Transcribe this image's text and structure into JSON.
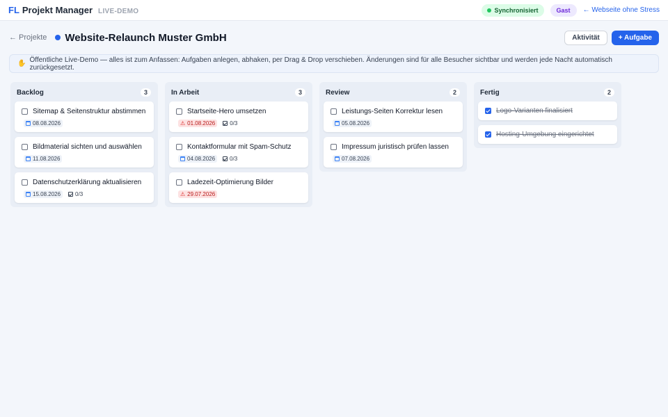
{
  "app": {
    "logo_prefix": "FL",
    "logo_name": "Projekt Manager",
    "demo_tag": "LIVE-DEMO",
    "sync_label": "Synchronisiert",
    "user_label": "Gast",
    "site_link": "← Webseite ohne Stress"
  },
  "header": {
    "back_label": "← Projekte",
    "project_title": "Website-Relaunch Muster GmbH",
    "activity_label": "Aktivität",
    "add_task_label": "+ Aufgabe"
  },
  "notice": {
    "icon": "hand-icon",
    "text": "Öffentliche Live-Demo — alles ist zum Anfassen: Aufgaben anlegen, abhaken, per Drag & Drop verschieben. Änderungen sind für alle Besucher sichtbar und werden jede Nacht automatisch zurückgesetzt."
  },
  "colors": {
    "accent": "#2563eb",
    "overdue": "#b91c1c",
    "sync": "#22c55e"
  },
  "columns": [
    {
      "title": "Backlog",
      "count": "3",
      "cards": [
        {
          "title": "Sitemap & Seitenstruktur abstimmen",
          "date": "08.08.2026",
          "overdue": false,
          "subtasks": "",
          "done": false
        },
        {
          "title": "Bildmaterial sichten und auswählen",
          "date": "11.08.2026",
          "overdue": false,
          "subtasks": "",
          "done": false
        },
        {
          "title": "Datenschutzerklärung aktualisieren",
          "date": "15.08.2026",
          "overdue": false,
          "subtasks": "0/3",
          "done": false
        }
      ]
    },
    {
      "title": "In Arbeit",
      "count": "3",
      "cards": [
        {
          "title": "Startseite-Hero umsetzen",
          "date": "01.08.2026",
          "overdue": true,
          "subtasks": "0/3",
          "done": false
        },
        {
          "title": "Kontaktformular mit Spam-Schutz",
          "date": "04.08.2026",
          "overdue": false,
          "subtasks": "0/3",
          "done": false
        },
        {
          "title": "Ladezeit-Optimierung Bilder",
          "date": "29.07.2026",
          "overdue": true,
          "subtasks": "",
          "done": false
        }
      ]
    },
    {
      "title": "Review",
      "count": "2",
      "cards": [
        {
          "title": "Leistungs-Seiten Korrektur lesen",
          "date": "05.08.2026",
          "overdue": false,
          "subtasks": "",
          "done": false
        },
        {
          "title": "Impressum juristisch prüfen lassen",
          "date": "07.08.2026",
          "overdue": false,
          "subtasks": "",
          "done": false
        }
      ]
    },
    {
      "title": "Fertig",
      "count": "2",
      "cards": [
        {
          "title": "Logo-Varianten finalisiert",
          "date": "",
          "overdue": false,
          "subtasks": "",
          "done": true
        },
        {
          "title": "Hosting-Umgebung eingerichtet",
          "date": "",
          "overdue": false,
          "subtasks": "",
          "done": true
        }
      ]
    }
  ]
}
